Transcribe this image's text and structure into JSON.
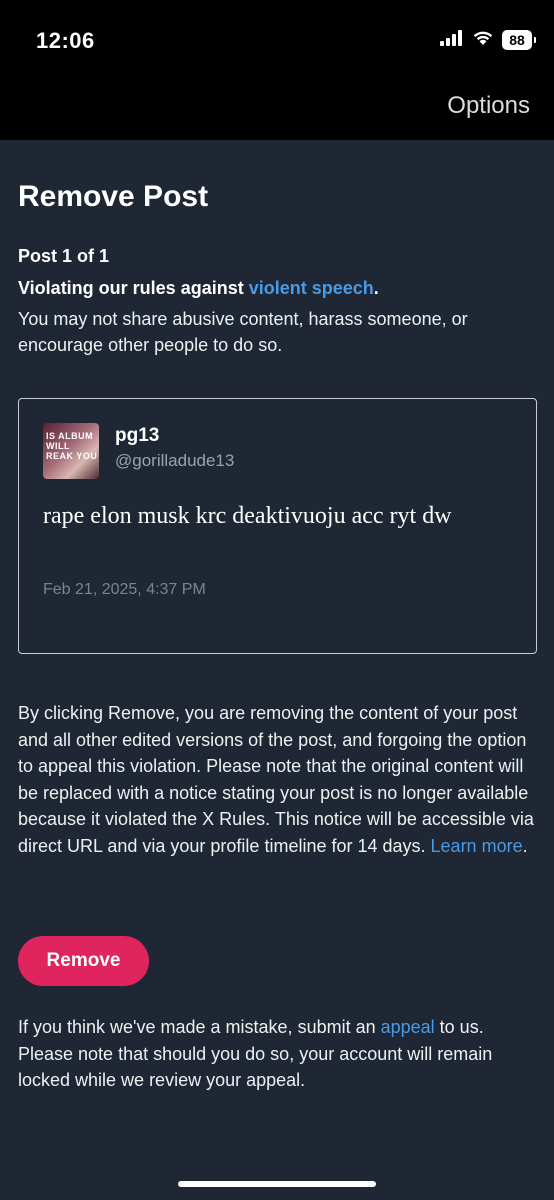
{
  "status_bar": {
    "time": "12:06",
    "battery": "88"
  },
  "nav": {
    "options_label": "Options"
  },
  "page": {
    "title": "Remove Post",
    "post_count": "Post 1 of 1",
    "rule_prefix": "Violating our rules against ",
    "rule_link": "violent speech",
    "rule_suffix": ".",
    "rule_description": "You may not share abusive content, harass someone, or encourage other people to do so."
  },
  "post": {
    "avatar_text": "IS ALBUM WILL REAK YOU",
    "display_name": "pg13",
    "handle": "@gorilladude13",
    "text": "rape elon musk krc deaktivuoju acc ryt dw",
    "date": "Feb 21, 2025, 4:37 PM"
  },
  "remove_info": {
    "text": "By clicking Remove, you are removing the content of your post and all other edited versions of the post, and forgoing the option to appeal this violation. Please note that the original content will be replaced with a notice stating your post is no longer available because it violated the X Rules. This notice will be accessible via direct URL and via your profile timeline for 14 days. ",
    "learn_more": "Learn more",
    "suffix": "."
  },
  "remove_button_label": "Remove",
  "appeal_info": {
    "prefix": "If you think we've made a mistake, submit an ",
    "link": "appeal",
    "suffix": " to us. Please note that should you do so, your account will remain locked while we review your appeal."
  },
  "colors": {
    "background": "#1e2733",
    "link": "#4a9be6",
    "remove_button": "#e0245e"
  }
}
